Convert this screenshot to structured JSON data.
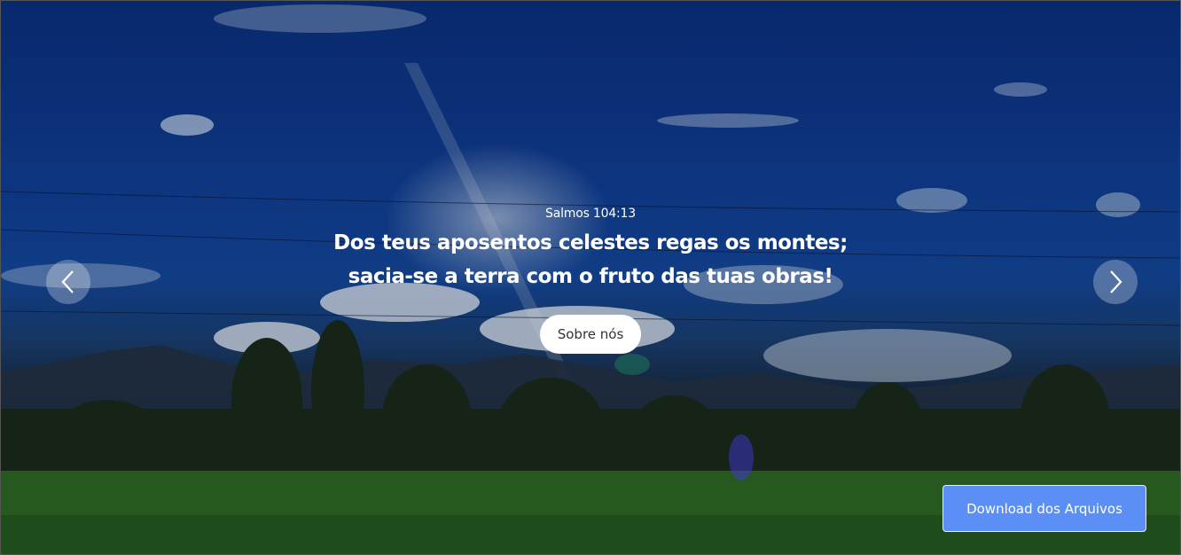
{
  "hero": {
    "verse_reference": "Salmos 104:13",
    "verse_lines": [
      "Dos teus aposentos celestes regas os montes;",
      "sacia-se a terra com o fruto das tuas obras!"
    ],
    "about_button_label": "Sobre nós",
    "prev_icon": "chevron-left-icon",
    "next_icon": "chevron-right-icon"
  },
  "download_button_label": "Download dos Arquivos",
  "colors": {
    "download_button": "#5b8ff5",
    "caption_text": "#ffffff",
    "about_button_bg": "#ffffff"
  }
}
